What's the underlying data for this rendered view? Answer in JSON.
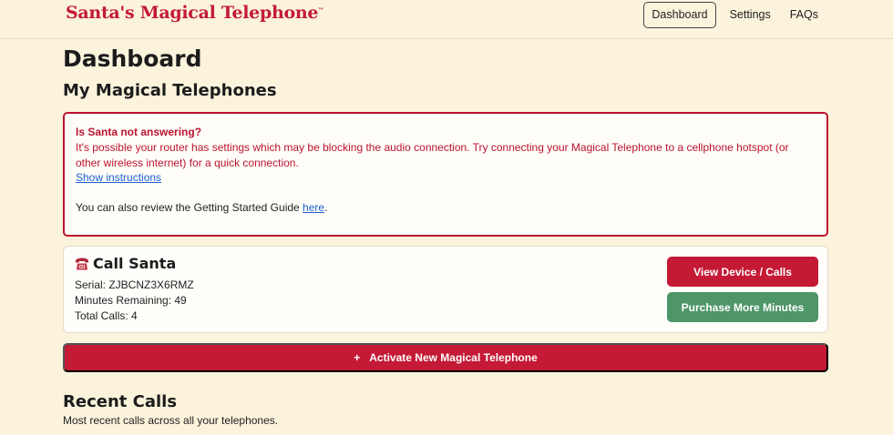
{
  "brand": {
    "name": "Santa's Magical Telephone",
    "trademark": "™"
  },
  "nav": {
    "items": [
      {
        "label": "Dashboard",
        "active": true
      },
      {
        "label": "Settings",
        "active": false
      },
      {
        "label": "FAQs",
        "active": false
      }
    ]
  },
  "page": {
    "title": "Dashboard",
    "section_title": "My Magical Telephones"
  },
  "alert": {
    "title": "Is Santa not answering?",
    "body": "It's possible your router has settings which may be blocking the audio connection. Try connecting your Magical Telephone to a cellphone hotspot (or other wireless internet) for a quick connection.",
    "show_instructions": "Show instructions",
    "guide_prefix": "You can also review the Getting Started Guide ",
    "guide_link": "here",
    "guide_suffix": "."
  },
  "device": {
    "icon": "telephone-icon",
    "name": "Call Santa",
    "serial": "Serial: ZJBCNZ3X6RMZ",
    "minutes": "Minutes Remaining: 49",
    "calls": "Total Calls: 4",
    "view_button": "View Device / Calls",
    "purchase_button": "Purchase More Minutes"
  },
  "activate": {
    "plus": "+",
    "label": "Activate New Magical Telephone"
  },
  "recent": {
    "title": "Recent Calls",
    "subtitle": "Most recent calls across all your telephones."
  },
  "colors": {
    "accent_red": "#c41a35",
    "success_green": "#4e9568",
    "background": "#fbf3dc",
    "link_blue": "#1a5fd6"
  }
}
